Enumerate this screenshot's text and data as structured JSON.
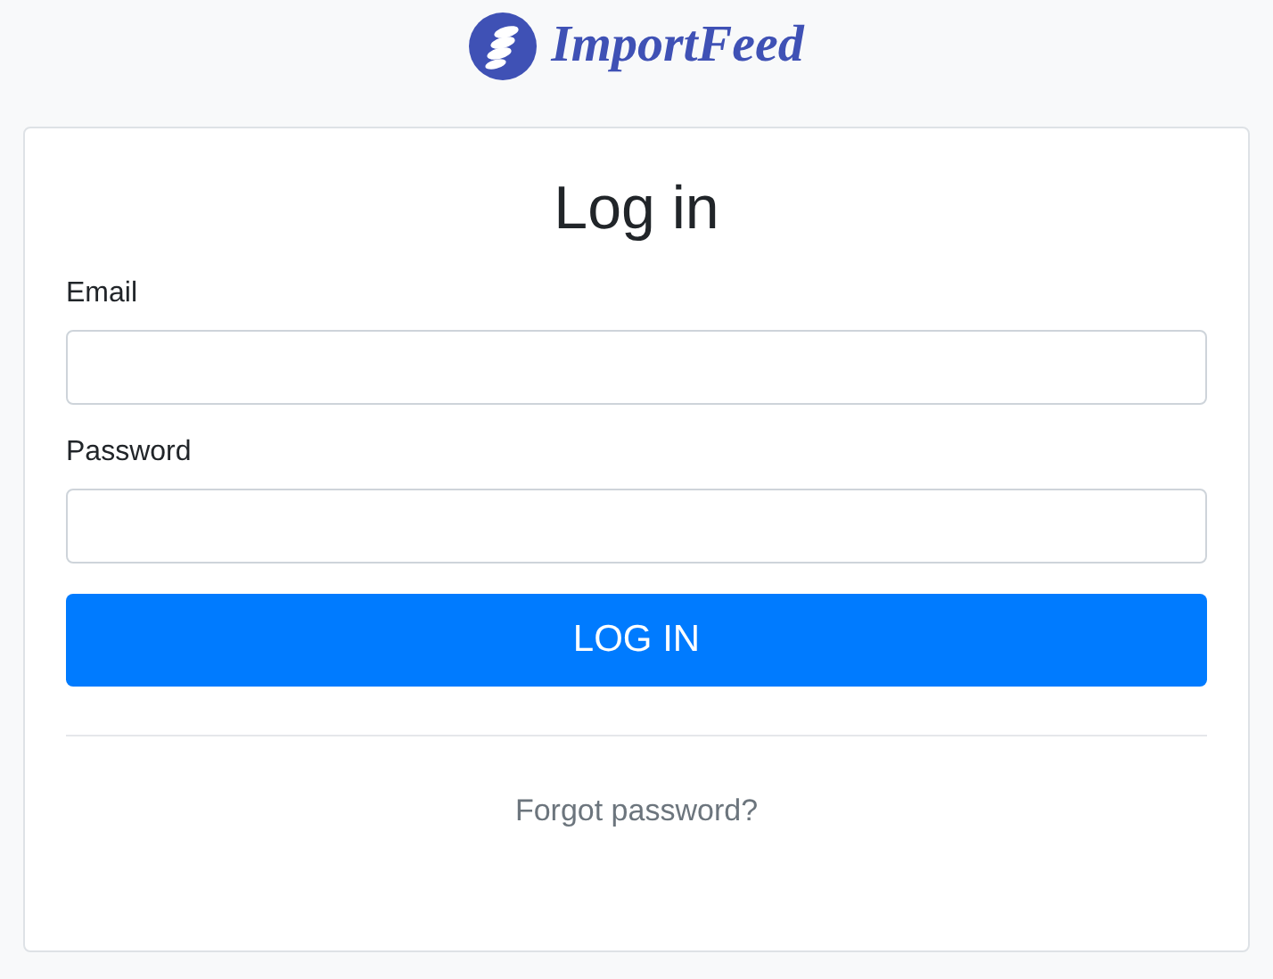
{
  "brand": {
    "name": "ImportFeed"
  },
  "form": {
    "title": "Log in",
    "fields": [
      {
        "label": "Email"
      },
      {
        "label": "Password"
      }
    ],
    "submit": "LOG IN",
    "forgot_link": "Forgot password?"
  }
}
